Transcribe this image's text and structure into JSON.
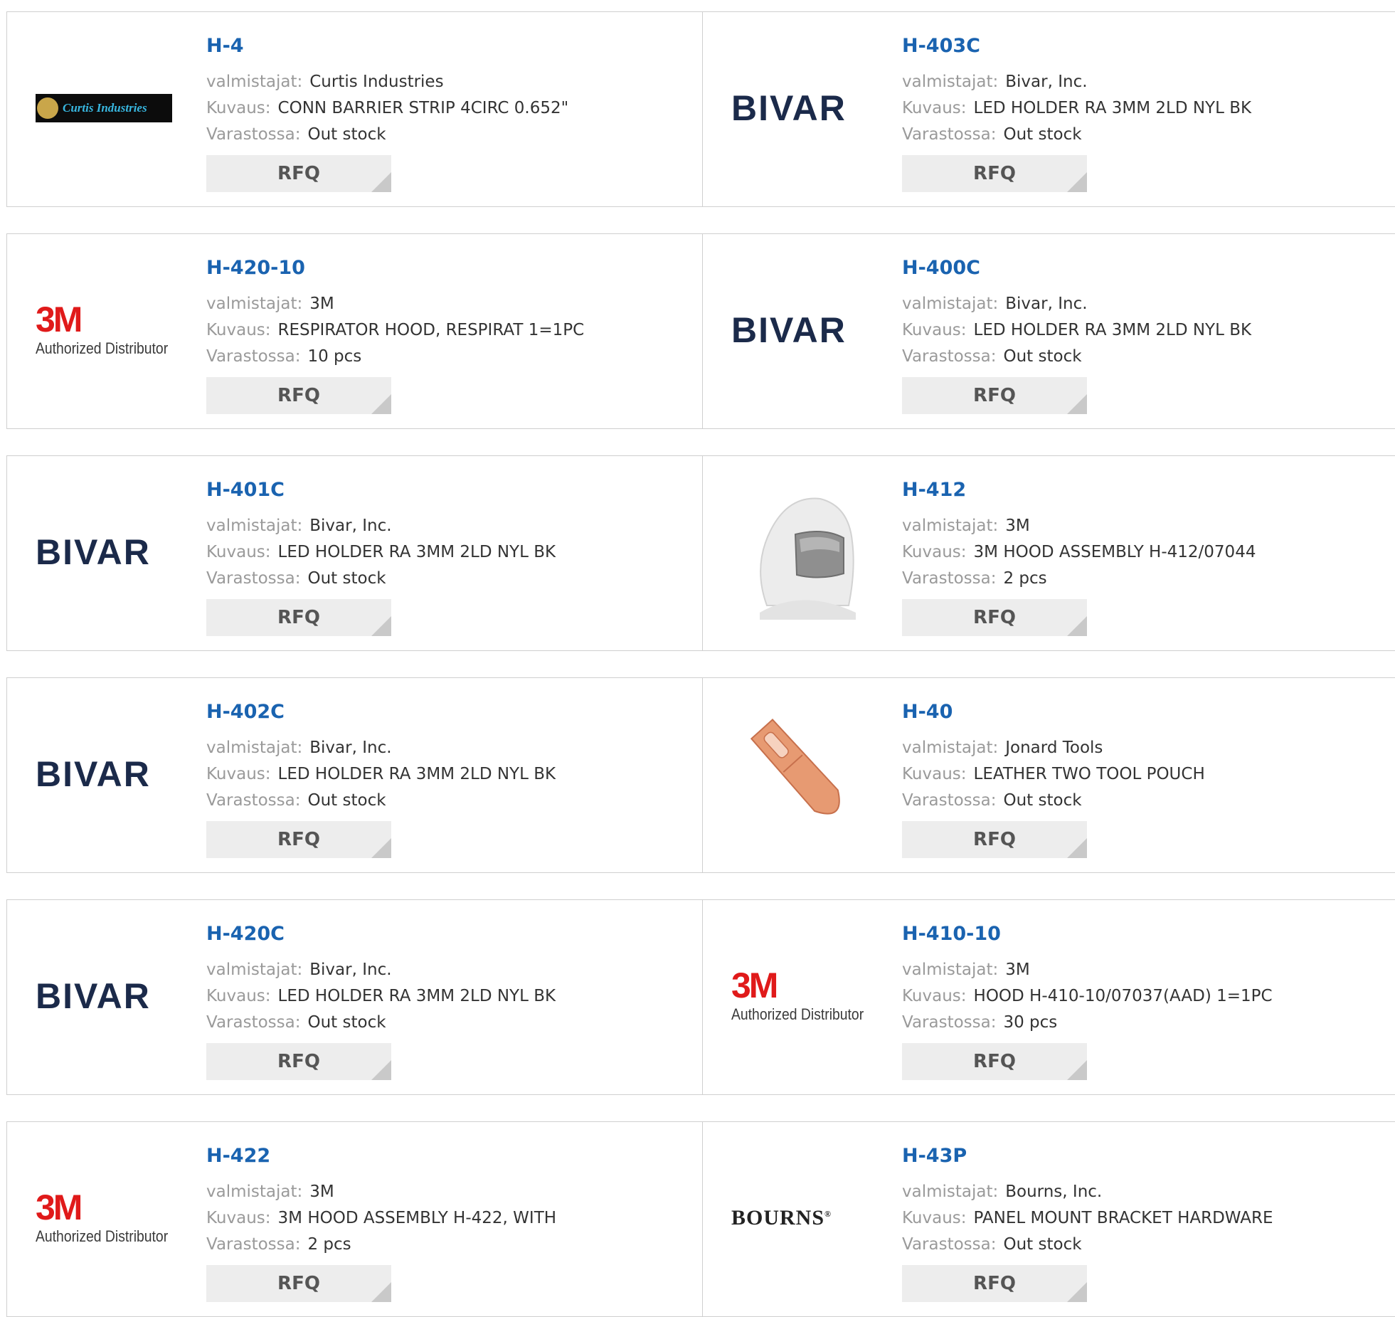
{
  "labels": {
    "manufacturer": "valmistajat:",
    "description": "Kuvaus:",
    "stock": "Varastossa:",
    "rfq": "RFQ"
  },
  "logos": {
    "bivar": "BIVAR",
    "threem_mark": "3M",
    "threem_sub": "Authorized Distributor",
    "curtis": "Curtis Industries",
    "bourns": "BOURNS"
  },
  "products": [
    {
      "pn": "H-4",
      "mfr": "Curtis Industries",
      "desc": "CONN BARRIER STRIP 4CIRC 0.652\"",
      "stock": "Out stock",
      "logo": "curtis"
    },
    {
      "pn": "H-403C",
      "mfr": "Bivar, Inc.",
      "desc": "LED HOLDER RA 3MM 2LD NYL BK",
      "stock": "Out stock",
      "logo": "bivar"
    },
    {
      "pn": "H-420-10",
      "mfr": "3M",
      "desc": "RESPIRATOR HOOD, RESPIRAT 1=1PC",
      "stock": "10 pcs",
      "logo": "3m"
    },
    {
      "pn": "H-400C",
      "mfr": "Bivar, Inc.",
      "desc": "LED HOLDER RA 3MM 2LD NYL BK",
      "stock": "Out stock",
      "logo": "bivar"
    },
    {
      "pn": "H-401C",
      "mfr": "Bivar, Inc.",
      "desc": "LED HOLDER RA 3MM 2LD NYL BK",
      "stock": "Out stock",
      "logo": "bivar"
    },
    {
      "pn": "H-412",
      "mfr": "3M",
      "desc": "3M HOOD ASSEMBLY H-412/07044",
      "stock": "2 pcs",
      "logo": "hood-photo"
    },
    {
      "pn": "H-402C",
      "mfr": "Bivar, Inc.",
      "desc": "LED HOLDER RA 3MM 2LD NYL BK",
      "stock": "Out stock",
      "logo": "bivar"
    },
    {
      "pn": "H-40",
      "mfr": "Jonard Tools",
      "desc": "LEATHER TWO TOOL POUCH",
      "stock": "Out stock",
      "logo": "pouch-photo"
    },
    {
      "pn": "H-420C",
      "mfr": "Bivar, Inc.",
      "desc": "LED HOLDER RA 3MM 2LD NYL BK",
      "stock": "Out stock",
      "logo": "bivar"
    },
    {
      "pn": "H-410-10",
      "mfr": "3M",
      "desc": "HOOD H-410-10/07037(AAD) 1=1PC",
      "stock": "30 pcs",
      "logo": "3m"
    },
    {
      "pn": "H-422",
      "mfr": "3M",
      "desc": "3M HOOD ASSEMBLY H-422, WITH",
      "stock": "2 pcs",
      "logo": "3m"
    },
    {
      "pn": "H-43P",
      "mfr": "Bourns, Inc.",
      "desc": "PANEL MOUNT BRACKET HARDWARE",
      "stock": "Out stock",
      "logo": "bourns"
    }
  ],
  "colors": {
    "part_number": "#1a63b0",
    "label": "#9a9a9a",
    "value": "#333333",
    "rfq_bg": "#ededed",
    "border": "#cfcfcf"
  }
}
